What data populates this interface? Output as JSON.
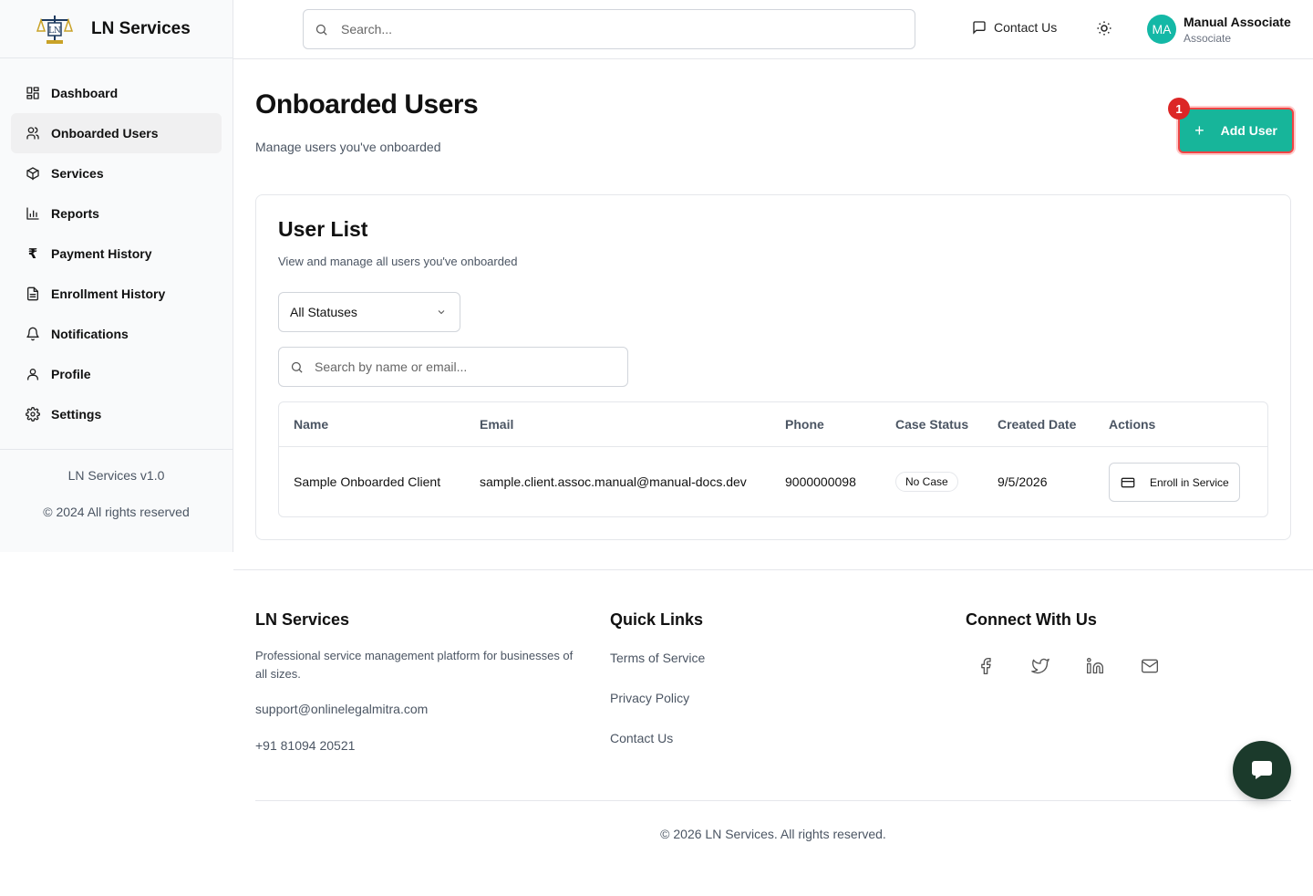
{
  "brand": {
    "name": "LN Services"
  },
  "sidebar": {
    "items": [
      {
        "label": "Dashboard",
        "icon": "dashboard-icon"
      },
      {
        "label": "Onboarded Users",
        "icon": "users-icon",
        "active": true
      },
      {
        "label": "Services",
        "icon": "box-icon"
      },
      {
        "label": "Reports",
        "icon": "bar-chart-icon"
      },
      {
        "label": "Payment History",
        "icon": "rupee-icon"
      },
      {
        "label": "Enrollment History",
        "icon": "document-icon"
      },
      {
        "label": "Notifications",
        "icon": "bell-icon"
      },
      {
        "label": "Profile",
        "icon": "user-icon"
      },
      {
        "label": "Settings",
        "icon": "gear-icon"
      }
    ],
    "version": "LN Services v1.0",
    "copyright": "© 2024 All rights reserved"
  },
  "header": {
    "search_placeholder": "Search...",
    "contact_label": "Contact Us",
    "user": {
      "initials": "MA",
      "name": "Manual Associate",
      "role": "Associate"
    }
  },
  "main": {
    "title": "Onboarded Users",
    "subtitle": "Manage users you've onboarded",
    "add_button": "Add User",
    "badge": "1",
    "card": {
      "title": "User List",
      "subtitle": "View and manage all users you've onboarded",
      "status_filter": "All Statuses",
      "search_placeholder": "Search by name or email...",
      "columns": [
        "Name",
        "Email",
        "Phone",
        "Case Status",
        "Created Date",
        "Actions"
      ],
      "rows": [
        {
          "name": "Sample Onboarded Client",
          "email": "sample.client.assoc.manual@manual-docs.dev",
          "phone": "9000000098",
          "case_status": "No Case",
          "created": "9/5/2026",
          "action": "Enroll in Service"
        }
      ]
    }
  },
  "footer": {
    "brand": "LN Services",
    "description": "Professional service management platform for businesses of all sizes.",
    "email": "support@onlinelegalmitra.com",
    "phone": "+91 81094 20521",
    "quick_links_title": "Quick Links",
    "links": [
      "Terms of Service",
      "Privacy Policy",
      "Contact Us"
    ],
    "connect_title": "Connect With Us",
    "social": [
      "facebook-icon",
      "twitter-icon",
      "linkedin-icon",
      "mail-icon"
    ],
    "copyright": "© 2026 LN Services. All rights reserved."
  },
  "colors": {
    "accent": "#17b59a",
    "avatar": "#14b8a6",
    "highlight": "#ef4444",
    "chat": "#1b3a2b"
  }
}
